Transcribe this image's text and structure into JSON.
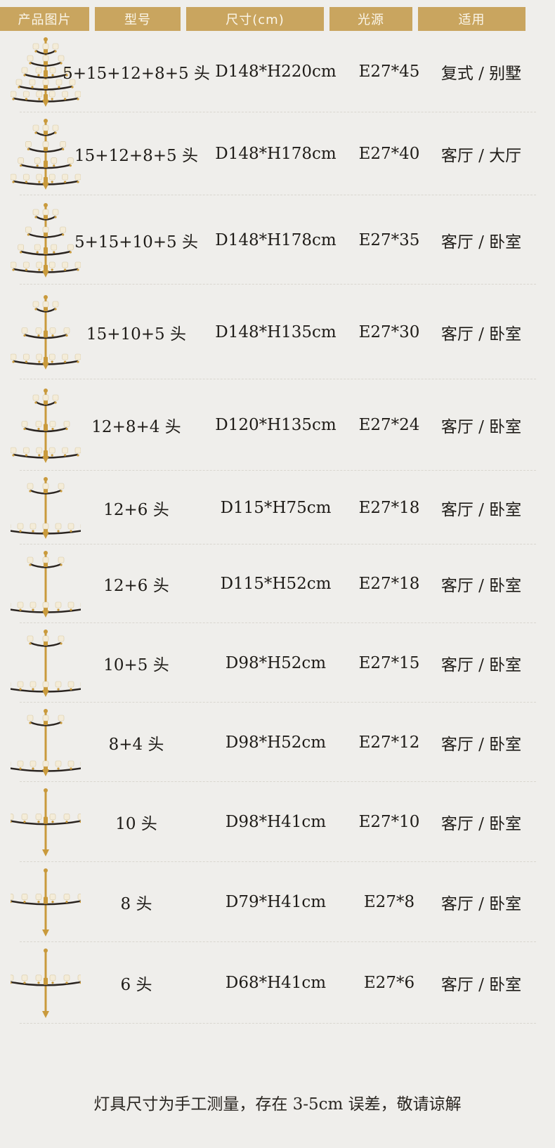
{
  "header": [
    "产品图片",
    "型号",
    "尺寸(cm)",
    "光源",
    "适用"
  ],
  "rows": [
    {
      "model": "5+15+12+8+5 头",
      "size": "D148*H220cm",
      "light": "E27*45",
      "use": "复式 / 别墅",
      "tiers": 5
    },
    {
      "model": "15+12+8+5 头",
      "size": "D148*H178cm",
      "light": "E27*40",
      "use": "客厅 / 大厅",
      "tiers": 4
    },
    {
      "model": "5+15+10+5 头",
      "size": "D148*H178cm",
      "light": "E27*35",
      "use": "客厅 / 卧室",
      "tiers": 4
    },
    {
      "model": "15+10+5 头",
      "size": "D148*H135cm",
      "light": "E27*30",
      "use": "客厅 / 卧室",
      "tiers": 3
    },
    {
      "model": "12+8+4 头",
      "size": "D120*H135cm",
      "light": "E27*24",
      "use": "客厅 / 卧室",
      "tiers": 3
    },
    {
      "model": "12+6 头",
      "size": "D115*H75cm",
      "light": "E27*18",
      "use": "客厅 / 卧室",
      "tiers": 2
    },
    {
      "model": "12+6 头",
      "size": "D115*H52cm",
      "light": "E27*18",
      "use": "客厅 / 卧室",
      "tiers": 2
    },
    {
      "model": "10+5 头",
      "size": "D98*H52cm",
      "light": "E27*15",
      "use": "客厅 / 卧室",
      "tiers": 2
    },
    {
      "model": "8+4 头",
      "size": "D98*H52cm",
      "light": "E27*12",
      "use": "客厅 / 卧室",
      "tiers": 2
    },
    {
      "model": "10 头",
      "size": "D98*H41cm",
      "light": "E27*10",
      "use": "客厅 / 卧室",
      "tiers": 1
    },
    {
      "model": "8 头",
      "size": "D79*H41cm",
      "light": "E27*8",
      "use": "客厅 / 卧室",
      "tiers": 1
    },
    {
      "model": "6 头",
      "size": "D68*H41cm",
      "light": "E27*6",
      "use": "客厅 / 卧室",
      "tiers": 1
    }
  ],
  "footer": "灯具尺寸为手工测量，存在  3-5cm 误差，敬请谅解",
  "colors": {
    "header_bg": "#c9a55f",
    "header_text": "#fbf6ea",
    "gold": "#c99a3c",
    "arm": "#2a2420",
    "shade": "#f4ecd8"
  }
}
